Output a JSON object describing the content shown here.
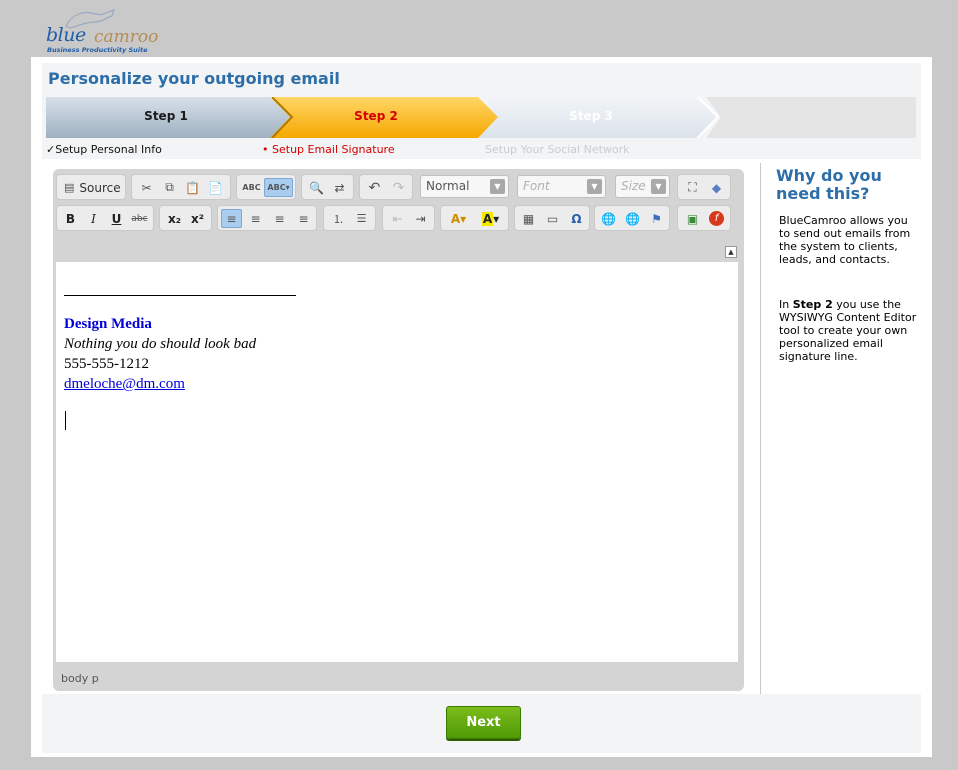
{
  "logo": {
    "word1": "blue",
    "word2": "camroo",
    "tagline": "Business Productivity Suite"
  },
  "page": {
    "title": "Personalize your outgoing email"
  },
  "steps": [
    {
      "label": "Step 1",
      "sublabel": "Setup Personal Info",
      "marker": "✓"
    },
    {
      "label": "Step 2",
      "sublabel": "Setup Email Signature",
      "marker": "•"
    },
    {
      "label": "Step 3",
      "sublabel": "Setup Your Social Network",
      "marker": ""
    }
  ],
  "toolbar": {
    "source_label": "Source",
    "format_value": "Normal",
    "font_placeholder": "Font",
    "size_placeholder": "Size"
  },
  "editor": {
    "company": "Design Media",
    "tagline": "Nothing you do should look bad",
    "phone": "555-555-1212",
    "email": "dmeloche@dm.com",
    "path": "body  p"
  },
  "sidebar": {
    "title": "Why do you need this?",
    "p1": "BlueCamroo allows you to send out emails from the system to clients, leads, and contacts.",
    "p2_pre": "In ",
    "p2_bold": "Step 2",
    "p2_post": " you use the WYSIWYG Content Editor tool to create your own personalized email signature line."
  },
  "footer": {
    "next_label": "Next"
  },
  "colors": {
    "accent": "#2d6ea8",
    "step_active": "#ffa500",
    "next_green": "#5fa80e"
  }
}
